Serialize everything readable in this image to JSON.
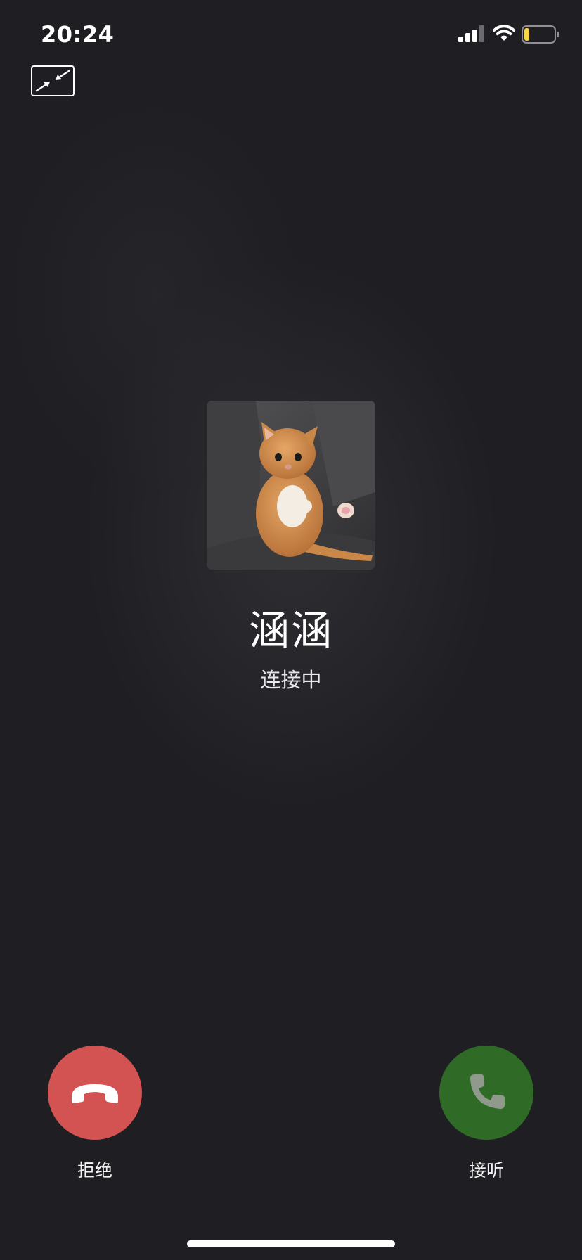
{
  "status_bar": {
    "time": "20:24",
    "signal_icon": "cellular-signal-icon",
    "wifi_icon": "wifi-icon",
    "battery_icon": "battery-low-icon",
    "battery_level": 0.1,
    "battery_color": "#f5d547"
  },
  "toolbar": {
    "minimize_icon": "minimize-window-icon"
  },
  "caller": {
    "name": "涵涵",
    "status": "连接中",
    "avatar": "orange-kitten-photo"
  },
  "actions": {
    "decline": {
      "label": "拒绝",
      "icon": "hang-up-phone-icon",
      "color": "#d35352"
    },
    "accept": {
      "label": "接听",
      "icon": "phone-icon",
      "color": "#2f6b27"
    }
  }
}
